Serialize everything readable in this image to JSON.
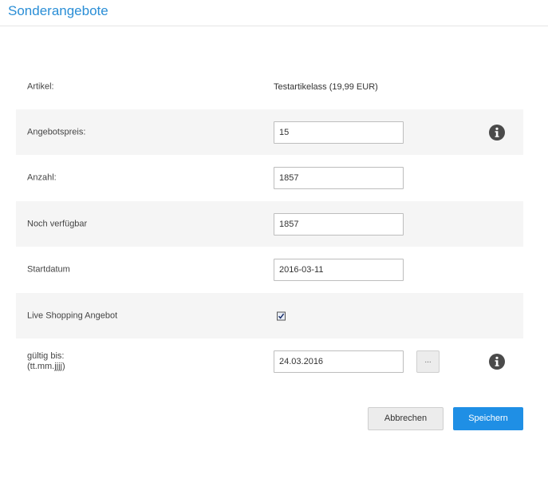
{
  "header": {
    "title": "Sonderangebote"
  },
  "form": {
    "artikel": {
      "label": "Artikel:",
      "value": "Testartikelass (19,99 EUR)"
    },
    "angebotspreis": {
      "label": "Angebotspreis:",
      "value": "15"
    },
    "anzahl": {
      "label": "Anzahl:",
      "value": "1857"
    },
    "noch_verfuegbar": {
      "label": "Noch verfügbar",
      "value": "1857"
    },
    "startdatum": {
      "label": "Startdatum",
      "value": "2016-03-11"
    },
    "live_shopping": {
      "label": "Live Shopping Angebot",
      "checked": true
    },
    "gueltig_bis": {
      "label_line1": "gültig bis:",
      "label_line2": "(tt.mm.jjjj)",
      "value": "24.03.2016",
      "picker_label": "..."
    }
  },
  "buttons": {
    "cancel": "Abbrechen",
    "save": "Speichern"
  },
  "colors": {
    "accent": "#1f8fe5",
    "title": "#2a8ed6",
    "row_shade": "#f5f5f5"
  },
  "icons": {
    "info": "info-circle-icon",
    "checkbox": "checkmark-icon"
  }
}
